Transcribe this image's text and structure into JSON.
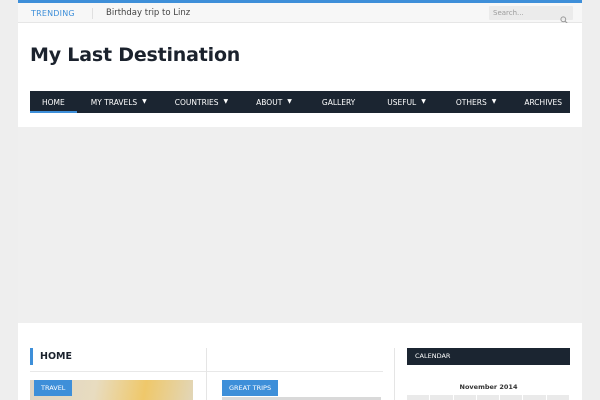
{
  "topbar": {
    "trending_label": "TRENDING",
    "trending_item": "Birthday trip to Linz",
    "search_placeholder": "Search..."
  },
  "header": {
    "site_title": "My Last Destination"
  },
  "nav": {
    "items": [
      {
        "label": "HOME",
        "dropdown": false,
        "active": true
      },
      {
        "label": "MY TRAVELS",
        "dropdown": true
      },
      {
        "label": "COUNTRIES",
        "dropdown": true
      },
      {
        "label": "ABOUT",
        "dropdown": true
      },
      {
        "label": "GALLERY",
        "dropdown": false
      },
      {
        "label": "USEFUL",
        "dropdown": true
      },
      {
        "label": "OTHERS",
        "dropdown": true
      },
      {
        "label": "ARCHIVES",
        "dropdown": false
      }
    ]
  },
  "main": {
    "section_title": "HOME",
    "posts": [
      {
        "category": "TRAVEL"
      },
      {
        "category": "GREAT TRIPS"
      }
    ]
  },
  "sidebar": {
    "calendar_heading": "CALENDAR",
    "calendar_month": "November 2014"
  },
  "colors": {
    "accent": "#3e8fd9",
    "nav_bg": "#1b2531",
    "page_bg": "#eeeeee"
  },
  "icons": {
    "search": "search-icon",
    "caret": "chevron-down-icon"
  }
}
